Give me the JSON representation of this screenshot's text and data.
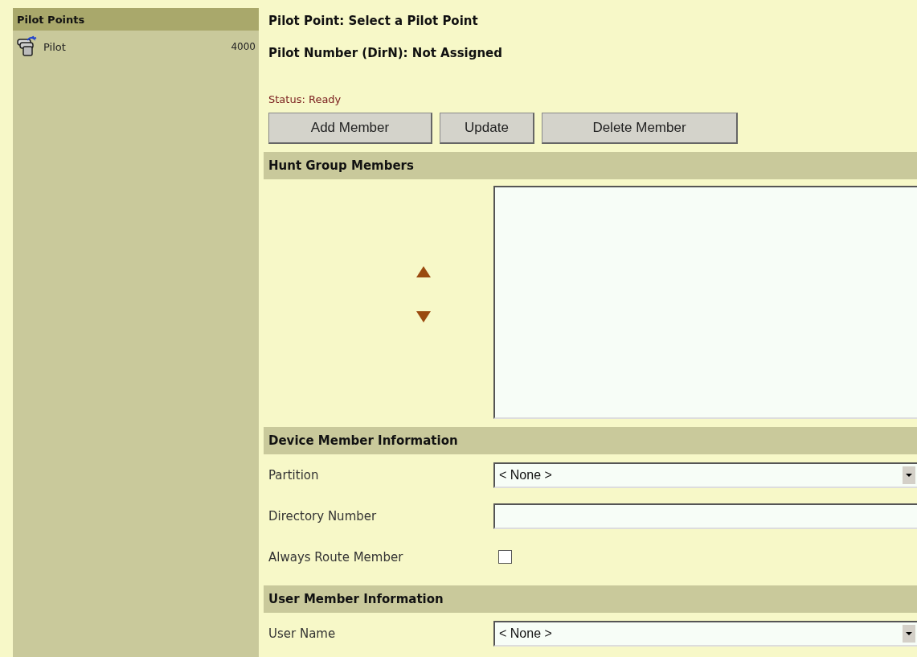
{
  "sidebar": {
    "title": "Pilot Points",
    "items": [
      {
        "label": "Pilot",
        "number": "4000"
      }
    ]
  },
  "header": {
    "pilot_point": "Pilot Point: Select a Pilot Point",
    "pilot_number": "Pilot Number (DirN): Not Assigned"
  },
  "status": "Status: Ready",
  "buttons": [
    "Add Member",
    "Update",
    "Delete Member"
  ],
  "hunt_group": {
    "title": "Hunt Group Members"
  },
  "sections": [
    {
      "title": "Device Member Information",
      "fields": [
        {
          "kind": "select",
          "label": "Partition",
          "value": "< None >"
        },
        {
          "kind": "text",
          "label": "Directory Number"
        },
        {
          "kind": "checkbox",
          "label": "Always Route Member",
          "checked": false
        }
      ]
    },
    {
      "title": "User Member Information",
      "fields": [
        {
          "kind": "select",
          "label": "User Name",
          "value": "< None >"
        }
      ]
    }
  ]
}
